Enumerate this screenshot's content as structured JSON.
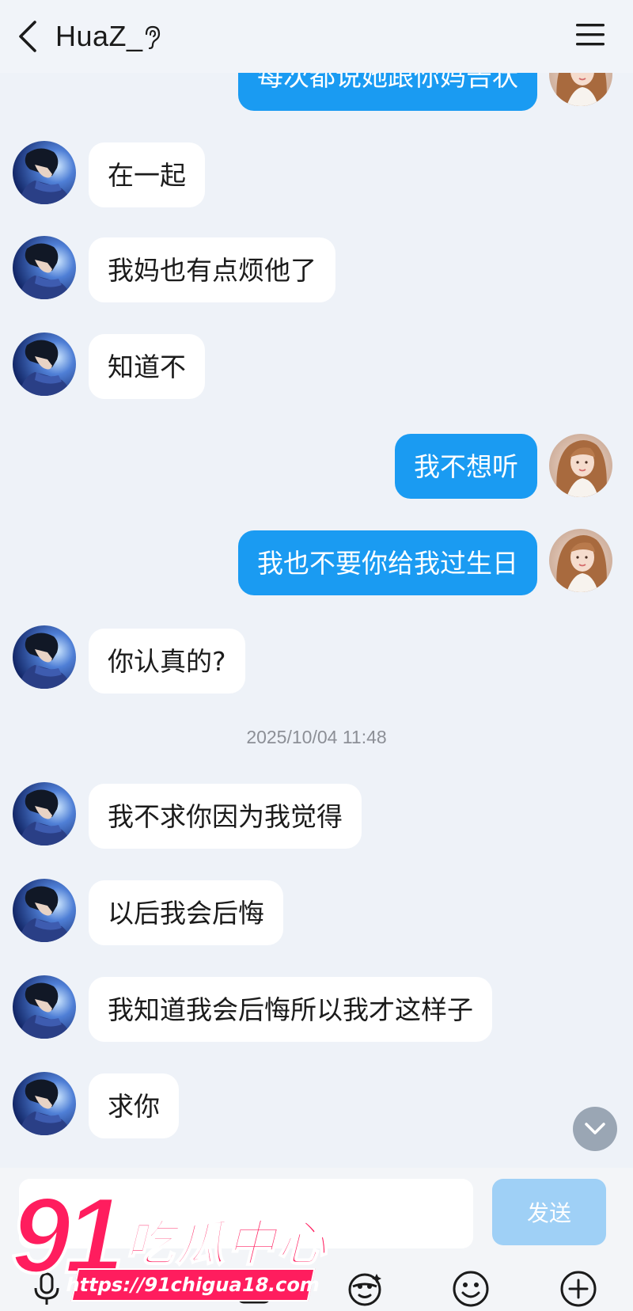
{
  "header": {
    "title": "HuaZ_"
  },
  "messages": {
    "m0": "每次都说她跟你妈告状",
    "m1": "在一起",
    "m2": "我妈也有点烦他了",
    "m3": "知道不",
    "m4": "我不想听",
    "m5": "我也不要你给我过生日",
    "m6": "你认真的?",
    "m7": "我不求你因为我觉得",
    "m8": "以后我会后悔",
    "m9": "我知道我会后悔所以我才这样子",
    "m10": "求你"
  },
  "timestamp": "2025/10/04 11:48",
  "input": {
    "send_label": "发送"
  },
  "watermark": {
    "number": "91",
    "brand": "吃瓜中心",
    "url": "https://91chigua18.com"
  },
  "icons": {
    "back": "chevron-left-icon",
    "ear": "ear-icon",
    "menu": "menu-icon",
    "scroll_down": "chevron-down-icon",
    "mic": "microphone-icon",
    "sticker": "sticker-icon",
    "emoji": "emoji-icon",
    "plus": "plus-icon"
  },
  "colors": {
    "outgoing_bubble": "#1a9bf2",
    "incoming_bubble": "#ffffff",
    "send_button": "#9fd0f6",
    "watermark": "#ff1d5e"
  }
}
